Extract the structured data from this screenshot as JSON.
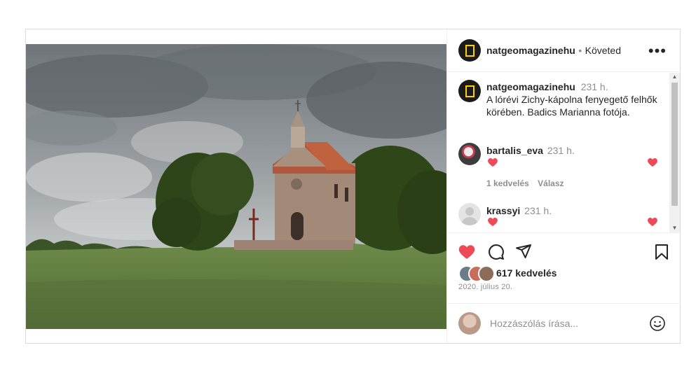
{
  "post": {
    "username": "natgeomagazinehu",
    "separator": "•",
    "follow_status": "Követed",
    "more_label": "•••"
  },
  "caption": {
    "username": "natgeomagazinehu",
    "time": "231 h.",
    "text_line1": "A lórévi Zichy-kápolna fenyegető felhők",
    "text_line2": "körében. Badics Marianna fotója."
  },
  "comments": [
    {
      "username": "bartalis_eva",
      "time": "231 h.",
      "likes": "1 kedvelés",
      "reply": "Válasz"
    },
    {
      "username": "krassyi",
      "time": "231 h."
    }
  ],
  "stats": {
    "likes": "617 kedvelés",
    "date": "2020. július 20."
  },
  "composer": {
    "placeholder": "Hozzászólás írása..."
  },
  "colors": {
    "like_red": "#ed4956",
    "ng_yellow": "#ffcf00",
    "muted": "#8e8e8e"
  }
}
